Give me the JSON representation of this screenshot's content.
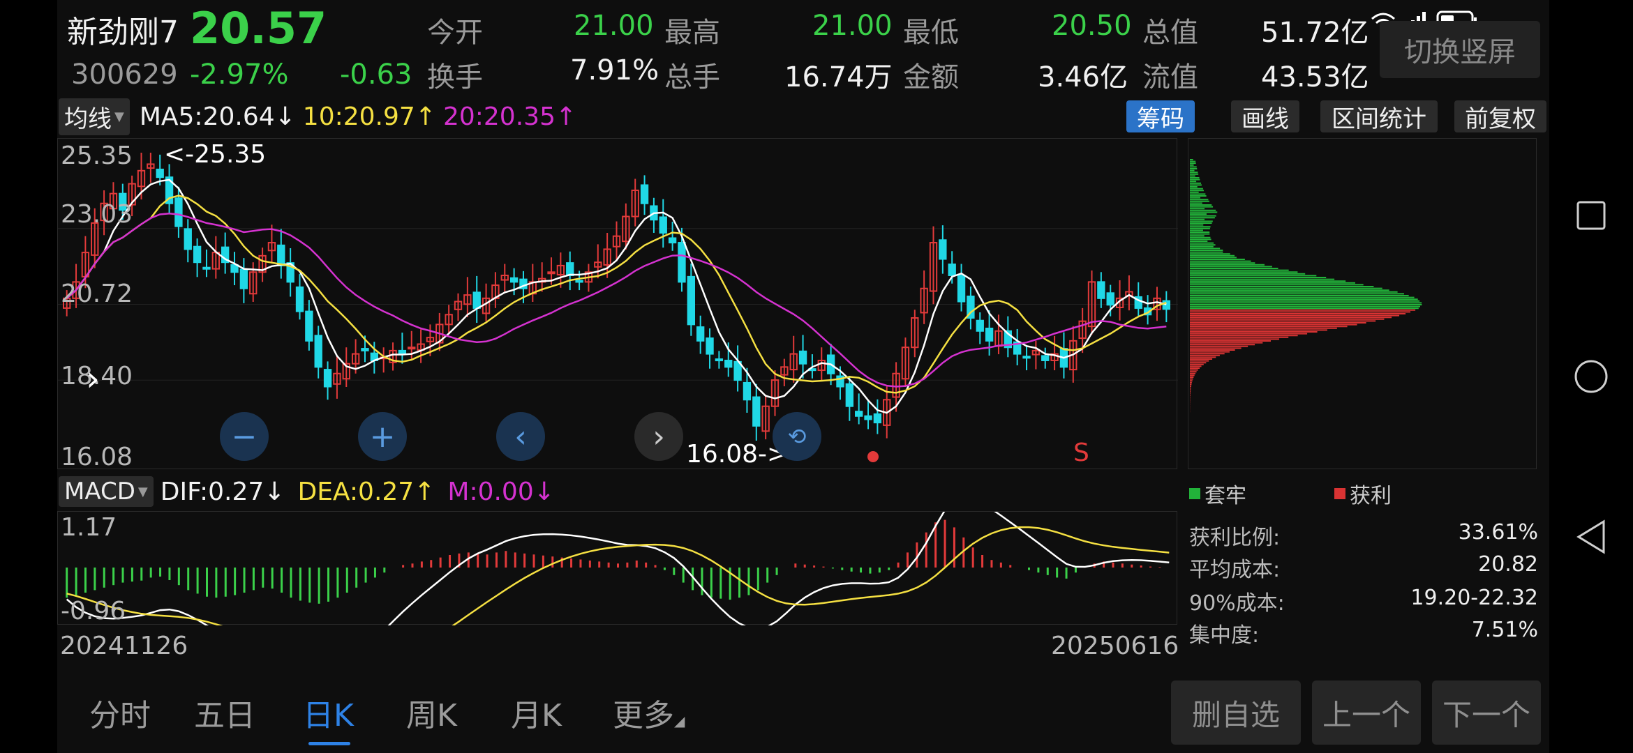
{
  "stock": {
    "name": "新劲刚",
    "name_suffix": "7",
    "code": "300629",
    "price": "20.57",
    "change_pct": "-2.97%",
    "change": "-0.63"
  },
  "quote": {
    "open_label": "今开",
    "open": "21.00",
    "high_label": "最高",
    "high": "21.00",
    "low_label": "最低",
    "low": "20.50",
    "mcap_label": "总值",
    "mcap": "51.72亿",
    "turnover_label": "换手",
    "turnover": "7.91%",
    "volume_label": "总手",
    "volume": "16.74万",
    "amount_label": "金额",
    "amount": "3.46亿",
    "float_label": "流值",
    "float": "43.53亿"
  },
  "switch_label": "切换竖屏",
  "ma_bar": {
    "selector": "均线",
    "ma5": "MA5:20.64↓",
    "ma10": "10:20.97↑",
    "ma20": "20:20.35↑"
  },
  "tools": [
    "筹码",
    "画线",
    "区间统计",
    "前复权"
  ],
  "price_axis": [
    "25.35",
    "23.03",
    "20.72",
    "18.40",
    "16.08"
  ],
  "annotations": {
    "high_marker": "<-25.35",
    "low_marker": "16.08->",
    "signal_s": "S"
  },
  "macd_bar": {
    "selector": "MACD",
    "dif": "DIF:0.27↓",
    "dea": "DEA:0.27↑",
    "m": "M:0.00↓"
  },
  "macd_axis": [
    "1.17",
    "-0.96"
  ],
  "date_start": "20241126",
  "date_end": "20250616",
  "chip_legend": {
    "trapped": "套牢",
    "profit": "获利"
  },
  "chip_stats": [
    {
      "k": "获利比例:",
      "v": "33.61%"
    },
    {
      "k": "平均成本:",
      "v": "20.82"
    },
    {
      "k": "90%成本:",
      "v": "19.20-22.32"
    },
    {
      "k": "集中度:",
      "v": "7.51%"
    }
  ],
  "tabs": [
    "分时",
    "五日",
    "日K",
    "周K",
    "月K",
    "更多"
  ],
  "bottom_buttons": [
    "删自选",
    "上一个",
    "下一个"
  ],
  "colors": {
    "up": "#e23a3a",
    "down": "#20d8e6",
    "green": "#3bd14a",
    "accent": "#2e82e6",
    "ma5": "#ffffff",
    "ma10": "#f5e042",
    "ma20": "#d532d0"
  },
  "chart_data": {
    "type": "candlestick",
    "ylim": [
      16.08,
      25.35
    ],
    "close": [
      20.9,
      21.4,
      22.3,
      23.2,
      23.8,
      24.1,
      23.6,
      24.4,
      24.8,
      25.0,
      24.6,
      23.8,
      23.1,
      22.4,
      22.0,
      21.8,
      22.3,
      22.0,
      21.7,
      21.2,
      21.7,
      22.2,
      22.6,
      21.9,
      21.4,
      20.5,
      19.6,
      18.8,
      18.2,
      18.6,
      18.9,
      19.2,
      19.3,
      19.0,
      19.1,
      19.3,
      19.2,
      19.4,
      19.5,
      19.7,
      20.1,
      20.4,
      20.8,
      21.0,
      20.6,
      20.9,
      21.3,
      21.6,
      21.4,
      21.2,
      21.4,
      21.5,
      21.7,
      21.9,
      21.6,
      21.4,
      21.7,
      22.0,
      22.4,
      22.8,
      23.4,
      24.2,
      23.8,
      23.3,
      22.9,
      22.6,
      21.4,
      20.1,
      19.6,
      19.2,
      19.0,
      18.8,
      18.4,
      17.8,
      17.0,
      17.6,
      18.4,
      18.8,
      19.2,
      18.9,
      18.7,
      19.0,
      18.6,
      18.2,
      17.6,
      17.3,
      17.2,
      17.1,
      17.8,
      18.6,
      19.4,
      20.3,
      21.2,
      22.6,
      22.1,
      21.6,
      20.8,
      20.3,
      19.9,
      19.6,
      19.9,
      19.4,
      19.2,
      19.1,
      19.3,
      19.0,
      19.2,
      18.8,
      19.6,
      20.2,
      21.4,
      20.9,
      20.7,
      20.9,
      21.1,
      20.6,
      20.4,
      20.9,
      20.57
    ],
    "macd_hist": [
      -0.6,
      -0.55,
      -0.5,
      -0.45,
      -0.4,
      -0.35,
      -0.3,
      -0.28,
      -0.26,
      -0.2,
      -0.18,
      -0.25,
      -0.35,
      -0.45,
      -0.52,
      -0.58,
      -0.6,
      -0.58,
      -0.55,
      -0.5,
      -0.45,
      -0.4,
      -0.42,
      -0.5,
      -0.6,
      -0.66,
      -0.7,
      -0.72,
      -0.68,
      -0.6,
      -0.5,
      -0.4,
      -0.3,
      -0.2,
      -0.1,
      0.0,
      0.05,
      0.08,
      0.12,
      0.15,
      0.2,
      0.25,
      0.28,
      0.3,
      0.28,
      0.26,
      0.3,
      0.33,
      0.3,
      0.28,
      0.26,
      0.24,
      0.22,
      0.2,
      0.18,
      0.16,
      0.14,
      0.12,
      0.1,
      0.08,
      0.1,
      0.14,
      0.1,
      0.05,
      -0.05,
      -0.15,
      -0.3,
      -0.45,
      -0.55,
      -0.6,
      -0.62,
      -0.64,
      -0.6,
      -0.55,
      -0.45,
      -0.3,
      -0.15,
      0.0,
      0.08,
      0.06,
      0.04,
      0.02,
      -0.02,
      -0.05,
      -0.08,
      -0.1,
      -0.12,
      -0.1,
      -0.05,
      0.1,
      0.3,
      0.5,
      0.7,
      0.9,
      0.95,
      0.8,
      0.6,
      0.4,
      0.25,
      0.15,
      0.1,
      0.05,
      0.0,
      -0.05,
      -0.1,
      -0.15,
      -0.2,
      -0.22,
      -0.1,
      0.0,
      0.08,
      0.12,
      0.1,
      0.08,
      0.06,
      0.04,
      0.02,
      0.01,
      0.0
    ]
  }
}
